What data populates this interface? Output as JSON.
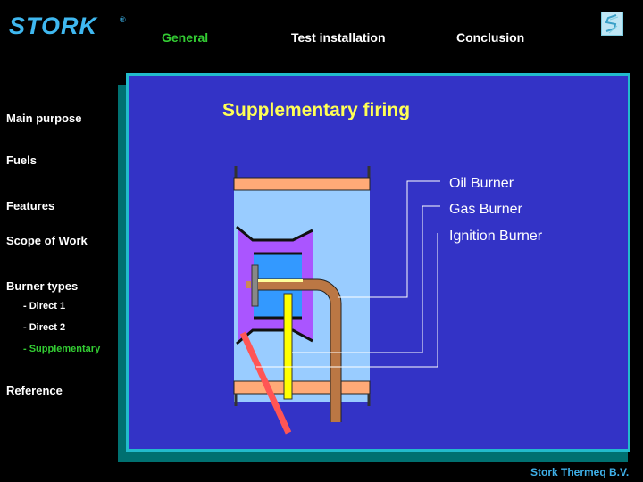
{
  "brand": {
    "logo_text": "STORK",
    "registered_mark": "®"
  },
  "header": {
    "tabs": [
      {
        "label": "General",
        "active": true
      },
      {
        "label": "Test installation",
        "active": false
      },
      {
        "label": "Conclusion",
        "active": false
      }
    ],
    "corner_icon": "stork-emblem-icon"
  },
  "sidebar": {
    "items": [
      {
        "label": "Main purpose"
      },
      {
        "label": "Fuels"
      },
      {
        "label": "Features"
      },
      {
        "label": "Scope of Work"
      },
      {
        "label": "Burner types"
      },
      {
        "label": "- Direct 1"
      },
      {
        "label": "- Direct 2"
      },
      {
        "label": "- Supplementary"
      },
      {
        "label": "Reference"
      }
    ],
    "active_item": "- Supplementary"
  },
  "main": {
    "title": "Supplementary firing",
    "callouts": [
      "Oil Burner",
      "Gas Burner",
      "Ignition Burner"
    ]
  },
  "colors": {
    "accent_green": "#33cc33",
    "title_yellow": "#ffff55",
    "panel_blue": "#3333c6",
    "footer_blue": "#3fb0e8"
  },
  "footer": {
    "company": "Stork Thermeq B.V."
  }
}
